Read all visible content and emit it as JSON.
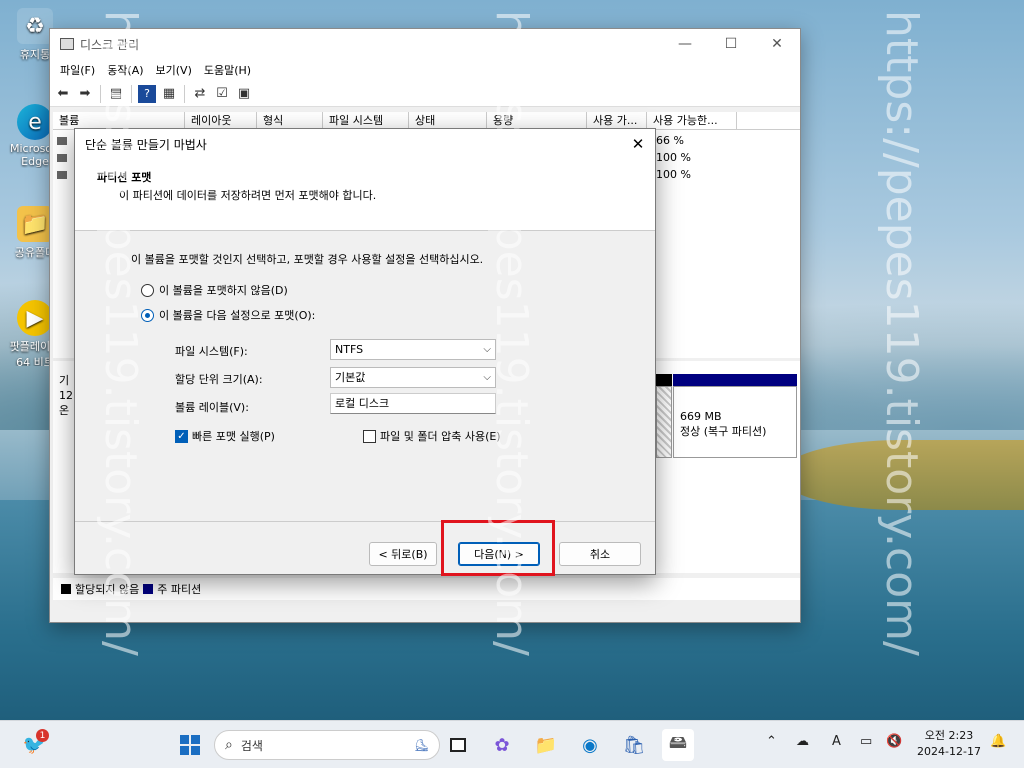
{
  "desktop": {
    "icons": [
      "휴지통",
      "Microsoft Edge",
      "공유폴더",
      "팟플레이어 64 비트"
    ],
    "watermark": "https://pepes119.tistory.com/"
  },
  "main_window": {
    "title": "디스크 관리",
    "menu": [
      "파일(F)",
      "동작(A)",
      "보기(V)",
      "도움말(H)"
    ],
    "columns": [
      "볼륨",
      "레이아웃",
      "형식",
      "파일 시스템",
      "상태",
      "용량",
      "사용 가...",
      "사용 가능한..."
    ],
    "rows": [
      {
        "free_pct": "66 %"
      },
      {
        "free_pct": "100 %"
      },
      {
        "free_pct": "100 %"
      }
    ],
    "disk_label_lines": [
      "기",
      "12",
      "온"
    ],
    "partition": {
      "size": "669 MB",
      "status": "정상 (복구 파티션)"
    },
    "legend": {
      "unallocated": "할당되지 않음",
      "primary": "주 파티션",
      "unallocated_color": "#000000",
      "primary_color": "#000080"
    }
  },
  "wizard": {
    "title": "단순 볼륨 만들기 마법사",
    "heading": "파티션 포맷",
    "subheading": "이 파티션에 데이터를 저장하려면 먼저 포맷해야 합니다.",
    "instruction": "이 볼륨을 포맷할 것인지 선택하고, 포맷할 경우 사용할 설정을 선택하십시오.",
    "radio_no_format": "이 볼륨을 포맷하지 않음(D)",
    "radio_format": "이 볼륨을 다음 설정으로 포맷(O):",
    "fs_label": "파일 시스템(F):",
    "fs_value": "NTFS",
    "alloc_label": "할당 단위 크기(A):",
    "alloc_value": "기본값",
    "vol_label_label": "볼륨 레이블(V):",
    "vol_label_value": "로컬 디스크",
    "quick_format": "빠른 포맷 실행(P)",
    "compress": "파일 및 폴더 압축 사용(E)",
    "btn_back": "< 뒤로(B)",
    "btn_next": "다음(N) >",
    "btn_cancel": "취소",
    "highlight_color": "#e0141e"
  },
  "taskbar": {
    "search_placeholder": "검색",
    "notification_badge": "1",
    "tray_lang": "A",
    "clock_time": "오전 2:23",
    "clock_date": "2024-12-17"
  }
}
